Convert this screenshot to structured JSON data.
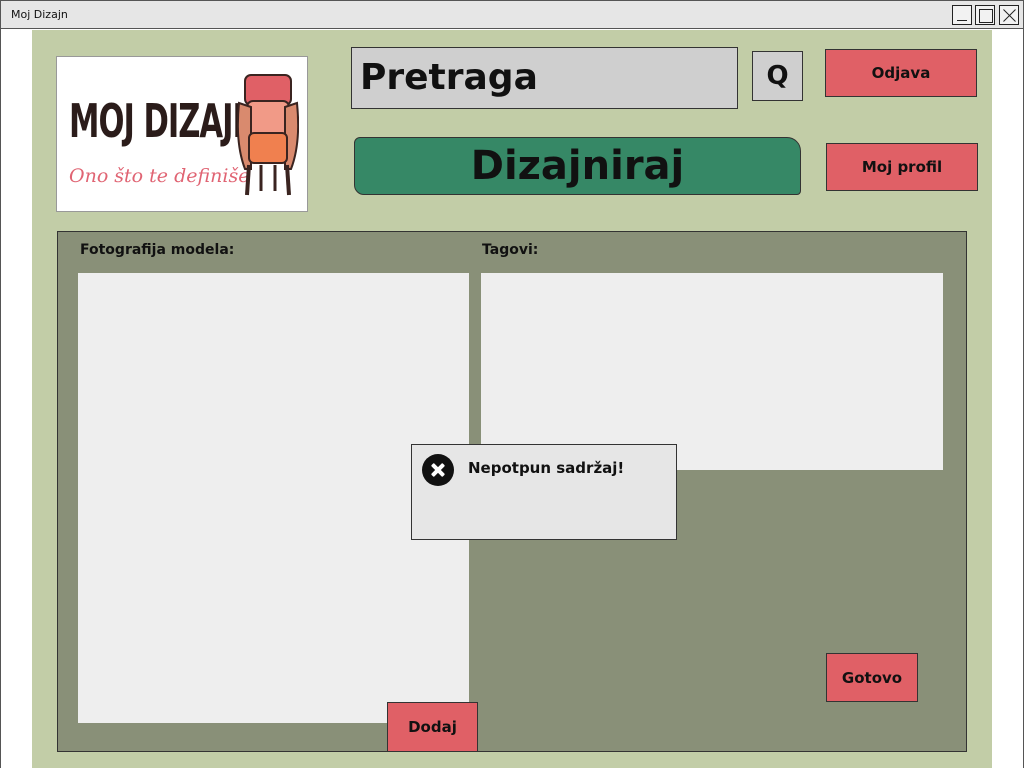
{
  "window": {
    "title": "Moj Dizajn"
  },
  "logo": {
    "brand": "MOJ DIZAJN",
    "tagline": "Ono što te definiše"
  },
  "search": {
    "placeholder": "Pretraga",
    "button_label": "Q"
  },
  "header": {
    "logout_label": "Odjava",
    "profile_label": "Moj profil",
    "design_label": "Dizajniraj"
  },
  "form": {
    "photo_label": "Fotografija modela:",
    "tags_label": "Tagovi:",
    "add_label": "Dodaj",
    "done_label": "Gotovo"
  },
  "alert": {
    "message": "Nepotpun sadržaj!",
    "icon": "error-x-icon"
  },
  "colors": {
    "background": "#c2cda7",
    "panel": "#899078",
    "accent_red": "#e06066",
    "accent_green": "#368866",
    "logo_pink": "#e06473"
  }
}
